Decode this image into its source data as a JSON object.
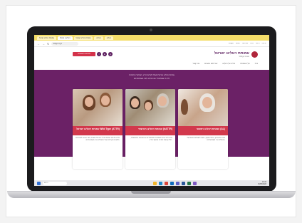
{
  "browser": {
    "tabs": [
      "עמותת ויטליגו ישראל",
      "ויטליגו | ישראל",
      "עמותת ויטליגו ישראל",
      "ויטליגו",
      "ויטליגו"
    ],
    "url": "vitiligo.org.il",
    "bookmarks": [
      "Google",
      "Gmail",
      "YouTube",
      "מפות",
      "תרגום",
      "חדשות"
    ]
  },
  "site": {
    "logo_title": "עמותת ויטליגו ישראל",
    "logo_sub": "Vitiligo Israel",
    "donate_label": "לתרומה לעמותה",
    "social": [
      "f",
      "in",
      "yt"
    ],
    "menu": [
      "בית",
      "על העמותה",
      "מידע על ויטליגו",
      "שירותים ומענים",
      "צור קשר"
    ],
    "intro_line1": "עמותת ויטליגו ישראל פועלת לקידום הידע, המחקר והתמיכה",
    "intro_line2": "לכל מי שמתמודד עם ויטליגו ולבני משפחותיהם"
  },
  "cards": [
    {
      "title": "עמותת ויטליגו ישראל Wild Type (ATTR)",
      "body": "מידע על סוגי המחלה ודרכי הטיפול השונות, לצד הכוונה לשירותים ולמענים הקיימים עבור מטופלים ובני משפחותיהם."
    },
    {
      "title": "עמותת ויטליגו תורשתי (hATTR)",
      "body": "מידע וליווי עבור משפחות המתמודדות עם המחלה התורשתית, כולל קבוצות תמיכה ומפגשי מידע."
    },
    {
      "title": "עמותת ויטליגו ראשוני (AL)",
      "body": "מידע על אבחון, טיפול ומעקב, ומענה לשאלות נפוצות של מטופלים ובני משפחותיהם."
    }
  ],
  "taskbar": {
    "search_placeholder": "חיפוש",
    "time": "10:24",
    "date": "15/05/2023"
  }
}
